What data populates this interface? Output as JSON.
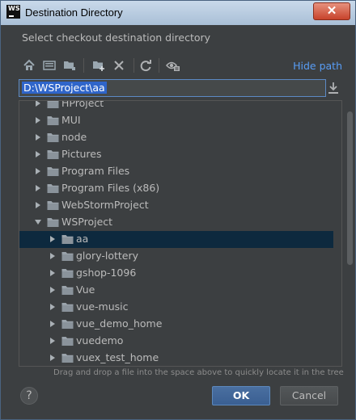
{
  "window": {
    "title": "Destination Directory",
    "app_icon_text": "WS",
    "close_label": "✕"
  },
  "dialog": {
    "subtitle": "Select checkout destination directory"
  },
  "toolbar": {
    "buttons": [
      "home-icon",
      "desktop-icon",
      "project-folder-icon",
      "new-folder-icon",
      "delete-icon",
      "refresh-icon",
      "show-hidden-icon"
    ],
    "hide_path_label": "Hide path"
  },
  "path": {
    "value": "D:\\WSProject\\aa"
  },
  "tree": {
    "items": [
      {
        "label": "HProject",
        "depth": 0,
        "expanded": false,
        "selected": false
      },
      {
        "label": "MUI",
        "depth": 0,
        "expanded": false,
        "selected": false
      },
      {
        "label": "node",
        "depth": 0,
        "expanded": false,
        "selected": false
      },
      {
        "label": "Pictures",
        "depth": 0,
        "expanded": false,
        "selected": false
      },
      {
        "label": "Program Files",
        "depth": 0,
        "expanded": false,
        "selected": false
      },
      {
        "label": "Program Files (x86)",
        "depth": 0,
        "expanded": false,
        "selected": false
      },
      {
        "label": "WebStormProject",
        "depth": 0,
        "expanded": false,
        "selected": false
      },
      {
        "label": "WSProject",
        "depth": 0,
        "expanded": true,
        "selected": false
      },
      {
        "label": "aa",
        "depth": 1,
        "expanded": false,
        "selected": true
      },
      {
        "label": "glory-lottery",
        "depth": 1,
        "expanded": false,
        "selected": false
      },
      {
        "label": "gshop-1096",
        "depth": 1,
        "expanded": false,
        "selected": false
      },
      {
        "label": "Vue",
        "depth": 1,
        "expanded": false,
        "selected": false
      },
      {
        "label": "vue-music",
        "depth": 1,
        "expanded": false,
        "selected": false
      },
      {
        "label": "vue_demo_home",
        "depth": 1,
        "expanded": false,
        "selected": false
      },
      {
        "label": "vuedemo",
        "depth": 1,
        "expanded": false,
        "selected": false
      },
      {
        "label": "vuex_test_home",
        "depth": 1,
        "expanded": false,
        "selected": false
      }
    ]
  },
  "hint": "Drag and drop a file into the space above to quickly locate it in the tree",
  "footer": {
    "help_label": "?",
    "ok_label": "OK",
    "cancel_label": "Cancel"
  },
  "colors": {
    "background": "#3c3f41",
    "selection": "#0d293e",
    "link": "#589df6",
    "text": "#bbbbbb"
  }
}
